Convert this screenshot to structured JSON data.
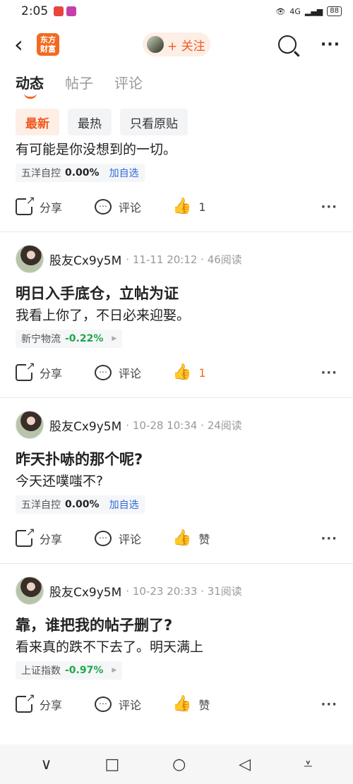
{
  "status": {
    "time": "2:05",
    "network": "4G",
    "battery": "88"
  },
  "header": {
    "brand_logo": "东方\n财富",
    "follow_label": "+ 关注"
  },
  "tabs": [
    {
      "label": "动态",
      "active": true
    },
    {
      "label": "帖子",
      "active": false
    },
    {
      "label": "评论",
      "active": false
    }
  ],
  "filters": [
    {
      "label": "最新",
      "active": true
    },
    {
      "label": "最热",
      "active": false
    },
    {
      "label": "只看原贴",
      "active": false
    }
  ],
  "posts": [
    {
      "author": "",
      "meta": "",
      "title": "",
      "body": "有可能是你没想到的一切。",
      "stock": {
        "name": "五洋自控",
        "change": "0.00%",
        "action": "加自选"
      },
      "share": "分享",
      "comment": "评论",
      "like": "1",
      "liked": false
    },
    {
      "author": "股友Cx9y5M",
      "meta": "· 11-11 20:12 · 46阅读",
      "title": "明日入手底仓，立帖为证",
      "body": "我看上你了，不日必来迎娶。",
      "stock": {
        "name": "新宁物流",
        "change": "-0.22%",
        "action": ""
      },
      "share": "分享",
      "comment": "评论",
      "like": "1",
      "liked": true
    },
    {
      "author": "股友Cx9y5M",
      "meta": "· 10-28 10:34 · 24阅读",
      "title": "昨天扑哧的那个呢?",
      "body": "今天还噗嗤不?",
      "stock": {
        "name": "五洋自控",
        "change": "0.00%",
        "action": "加自选"
      },
      "share": "分享",
      "comment": "评论",
      "like": "赞",
      "liked": false
    },
    {
      "author": "股友Cx9y5M",
      "meta": "· 10-23 20:33 · 31阅读",
      "title": "靠，谁把我的帖子删了?",
      "body": "看来真的跌不下去了。明天满上",
      "stock": {
        "name": "上证指数",
        "change": "-0.97%",
        "action": ""
      },
      "share": "分享",
      "comment": "评论",
      "like": "赞",
      "liked": false
    }
  ],
  "nav": {
    "down": "∨",
    "square": "□",
    "circle": "○",
    "back": "◁",
    "menu": "⩡"
  },
  "colors": {
    "accent": "#f26a21",
    "green": "#1fa84a",
    "link": "#2f6bd8"
  }
}
